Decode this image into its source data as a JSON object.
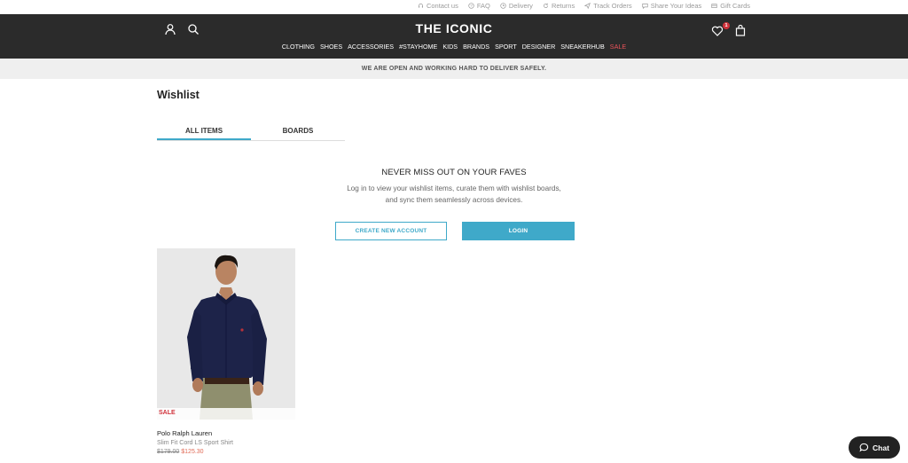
{
  "utility_links": [
    {
      "label": "Contact us",
      "icon": "headset-icon"
    },
    {
      "label": "FAQ",
      "icon": "help-icon"
    },
    {
      "label": "Delivery",
      "icon": "clock-icon"
    },
    {
      "label": "Returns",
      "icon": "refresh-icon"
    },
    {
      "label": "Track Orders",
      "icon": "send-icon"
    },
    {
      "label": "Share Your Ideas",
      "icon": "chat-bubble-icon"
    },
    {
      "label": "Gift Cards",
      "icon": "gift-card-icon"
    }
  ],
  "header": {
    "logo": "THE ICONIC",
    "wishlist_count": "1",
    "nav": [
      "CLOTHING",
      "SHOES",
      "ACCESSORIES",
      "#STAYHOME",
      "KIDS",
      "BRANDS",
      "SPORT",
      "DESIGNER",
      "SNEAKERHUB",
      "SALE"
    ]
  },
  "promo": "WE ARE OPEN AND WORKING HARD TO DELIVER SAFELY.",
  "page": {
    "title": "Wishlist",
    "tabs": [
      "ALL ITEMS",
      "BOARDS"
    ],
    "empty_title": "NEVER MISS OUT ON YOUR FAVES",
    "empty_desc_line1": "Log in to view your wishlist items, curate them with wishlist boards,",
    "empty_desc_line2": "and sync them seamlessly across devices.",
    "create_account": "CREATE NEW ACCOUNT",
    "login": "LOGIN"
  },
  "product": {
    "badge": "SALE",
    "brand": "Polo Ralph Lauren",
    "name": "Slim Fit Cord LS Sport Shirt",
    "old_price": "$179.00",
    "new_price": "$125.30"
  },
  "chat": {
    "label": "Chat"
  },
  "colors": {
    "accent": "#3fa9c9",
    "header_bg": "#2b2b2b",
    "sale": "#d0313a"
  }
}
